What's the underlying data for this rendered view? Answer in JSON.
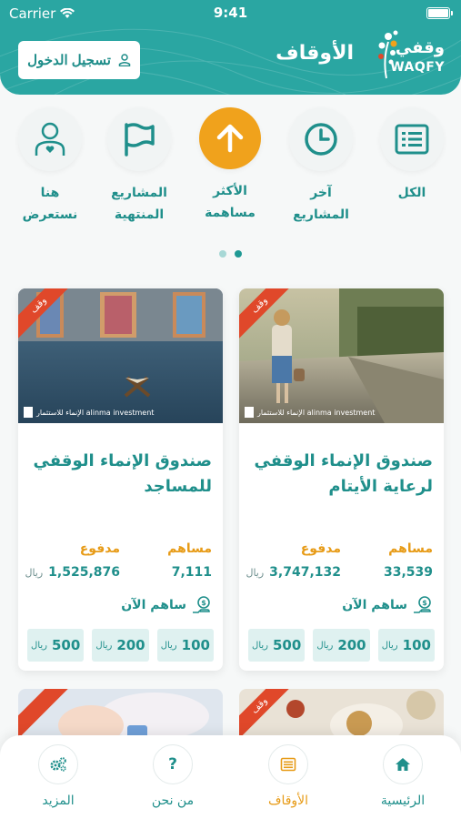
{
  "status": {
    "carrier": "Carrier",
    "time": "9:41"
  },
  "header": {
    "title": "الأوقاف",
    "login_label": "تسجيل الدخول",
    "logo_ar": "وقفي",
    "logo_en": "WAQFY"
  },
  "categories": [
    {
      "label": "الكل",
      "icon": "list-icon"
    },
    {
      "label": "آخر\nالمشاريع",
      "icon": "clock-icon"
    },
    {
      "label": "الأكثر\nمساهمة",
      "icon": "arrow-up-icon",
      "active": true
    },
    {
      "label": "المشاريع\nالمنتهية",
      "icon": "flag-icon"
    },
    {
      "label": "هنا\nنستعرض",
      "icon": "person-heart-icon"
    }
  ],
  "cards": [
    {
      "ribbon": "وقف",
      "brand": "الإنماء للاستثمار alinma investment",
      "title": "صندوق الإنماء الوقفي لرعاية الأيتام",
      "contributors_label": "مساهم",
      "contributors_value": "33,539",
      "paid_label": "مدفوع",
      "paid_value": "3,747,132",
      "currency": "ريال",
      "contribute_label": "ساهم الآن",
      "amounts": [
        "100",
        "200",
        "500"
      ]
    },
    {
      "ribbon": "وقف",
      "brand": "الإنماء للاستثمار alinma investment",
      "title": "صندوق الإنماء الوقفي للمساجد",
      "contributors_label": "مساهم",
      "contributors_value": "7,111",
      "paid_label": "مدفوع",
      "paid_value": "1,525,876",
      "currency": "ريال",
      "contribute_label": "ساهم الآن",
      "amounts": [
        "100",
        "200",
        "500"
      ]
    }
  ],
  "peek_ribbon": "وقف",
  "bottom_nav": [
    {
      "label": "الرئيسية",
      "icon": "home-icon"
    },
    {
      "label": "الأوقاف",
      "icon": "document-icon",
      "active": true
    },
    {
      "label": "من نحن",
      "icon": "question-icon"
    },
    {
      "label": "المزيد",
      "icon": "gears-icon"
    }
  ],
  "colors": {
    "primary": "#2aa6a2",
    "accent": "#f0a21c",
    "ribbon": "#e0482a"
  }
}
